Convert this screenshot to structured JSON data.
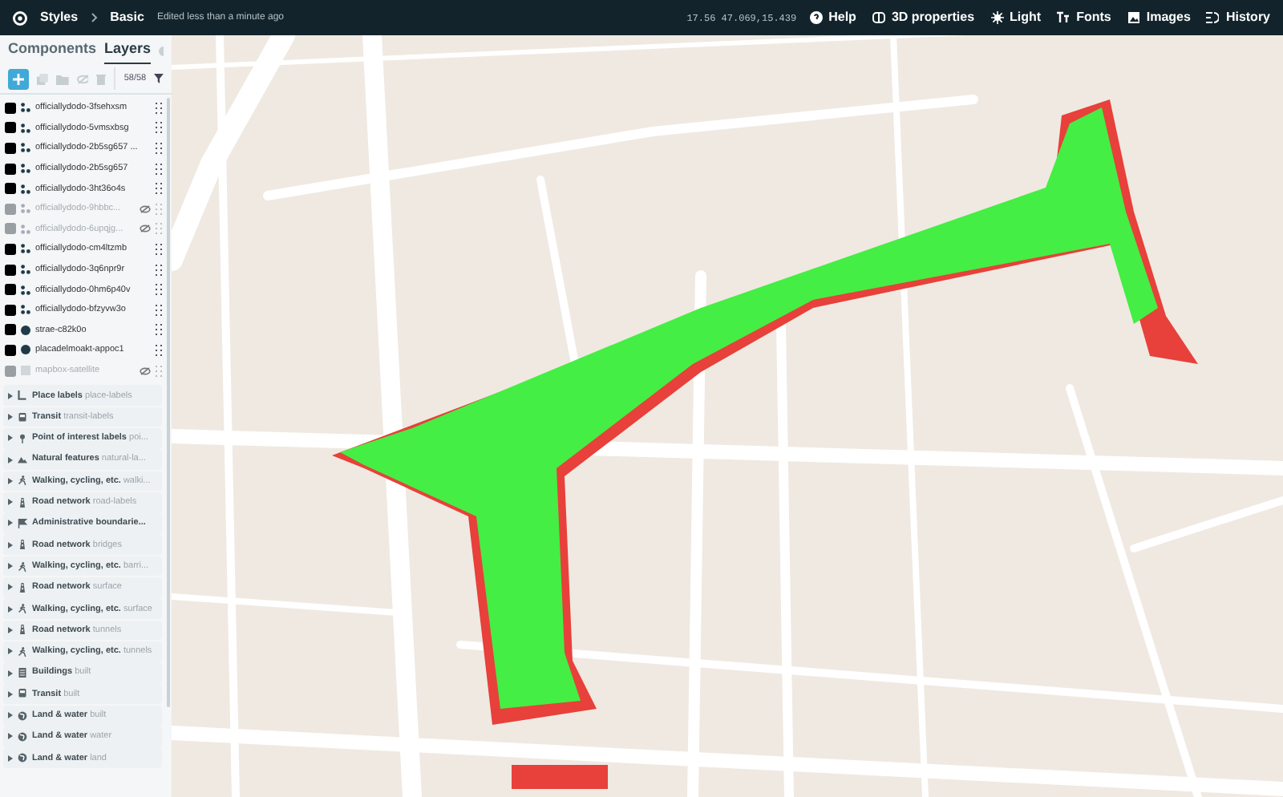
{
  "topbar": {
    "crumbs": [
      "Styles",
      "Basic"
    ],
    "edited": "Edited less than a minute ago",
    "coords": "17.56 47.069,15.439",
    "actions": [
      {
        "kind": "help",
        "label": "Help"
      },
      {
        "kind": "cube",
        "label": "3D properties"
      },
      {
        "kind": "sun",
        "label": "Light"
      },
      {
        "kind": "font",
        "label": "Fonts"
      },
      {
        "kind": "image",
        "label": "Images"
      },
      {
        "kind": "history",
        "label": "History"
      }
    ]
  },
  "sidebar": {
    "tabs": [
      {
        "label": "Components",
        "selected": false
      },
      {
        "label": "Layers",
        "selected": true
      }
    ],
    "count": "58/58",
    "layers": [
      {
        "name": "officiallydodo-3fsehxsm",
        "kind": "symbol",
        "hidden": false
      },
      {
        "name": "officiallydodo-5vmsxbsg",
        "kind": "symbol",
        "hidden": false
      },
      {
        "name": "officiallydodo-2b5sg657 ...",
        "kind": "symbol",
        "hidden": false
      },
      {
        "name": "officiallydodo-2b5sg657",
        "kind": "symbol",
        "hidden": false
      },
      {
        "name": "officiallydodo-3ht36o4s",
        "kind": "symbol",
        "hidden": false
      },
      {
        "name": "officiallydodo-9hbbc...",
        "kind": "symbol",
        "hidden": true
      },
      {
        "name": "officiallydodo-6upqjg...",
        "kind": "symbol",
        "hidden": true
      },
      {
        "name": "officiallydodo-cm4ltzmb",
        "kind": "symbol",
        "hidden": false
      },
      {
        "name": "officiallydodo-3q6npr9r",
        "kind": "symbol",
        "hidden": false
      },
      {
        "name": "officiallydodo-0hm6p40v",
        "kind": "symbol",
        "hidden": false
      },
      {
        "name": "officiallydodo-bfzyvw3o",
        "kind": "symbol",
        "hidden": false
      },
      {
        "name": "strae-c82k0o",
        "kind": "circle",
        "hidden": false
      },
      {
        "name": "placadelmoakt-appoc1",
        "kind": "circle",
        "hidden": false
      },
      {
        "name": "mapbox-satellite",
        "kind": "raster",
        "hidden": true
      }
    ],
    "groups": [
      {
        "title": "Place labels",
        "sub": "place-labels",
        "kind": "label"
      },
      {
        "title": "Transit",
        "sub": "transit-labels",
        "kind": "bus"
      },
      {
        "title": "Point of interest labels",
        "sub": "poi...",
        "kind": "pin"
      },
      {
        "title": "Natural features",
        "sub": "natural-la...",
        "kind": "mountain"
      },
      {
        "title": "Walking, cycling, etc.",
        "sub": "walki...",
        "kind": "walker"
      },
      {
        "title": "Road network",
        "sub": "road-labels",
        "kind": "road"
      },
      {
        "title": "Administrative boundarie...",
        "kind": "flag"
      },
      {
        "title": "Road network",
        "sub": "bridges",
        "kind": "road"
      },
      {
        "title": "Walking, cycling, etc.",
        "sub": "barri...",
        "kind": "walker"
      },
      {
        "title": "Road network",
        "sub": "surface",
        "kind": "road"
      },
      {
        "title": "Walking, cycling, etc.",
        "sub": "surface",
        "kind": "walker"
      },
      {
        "title": "Road network",
        "sub": "tunnels",
        "kind": "road"
      },
      {
        "title": "Walking, cycling, etc.",
        "sub": "tunnels",
        "kind": "walker"
      },
      {
        "title": "Buildings",
        "sub": "built",
        "kind": "building"
      },
      {
        "title": "Transit",
        "sub": "built",
        "kind": "bus"
      },
      {
        "title": "Land & water",
        "sub": "built",
        "kind": "globe"
      },
      {
        "title": "Land & water",
        "sub": "water",
        "kind": "globe"
      },
      {
        "title": "Land & water",
        "sub": "land",
        "kind": "globe"
      }
    ]
  }
}
